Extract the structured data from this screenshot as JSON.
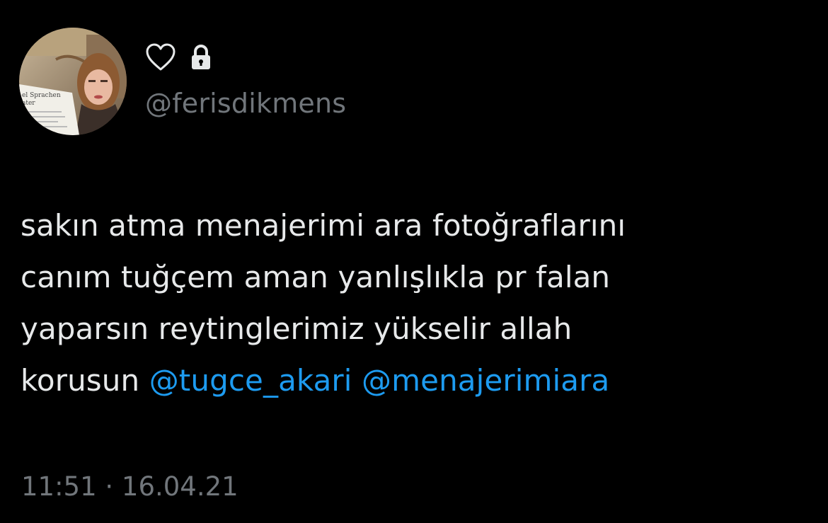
{
  "tweet": {
    "display_name_icons": [
      "heart-outline-icon",
      "lock-icon"
    ],
    "handle": "@ferisdikmens",
    "text_lines": [
      "sakın atma menajerimi ara fotoğraflarını",
      "canım tuğçem aman yanlışlıkla pr falan",
      "yaparsın reytinglerimiz yükselir allah",
      "korusun "
    ],
    "mentions": [
      "@tugce_akari",
      "@menajerimiara"
    ],
    "timestamp": "11:51 · 16.04.21",
    "avatar_newspaper_text": [
      "el Sprachen",
      "ater"
    ]
  },
  "colors": {
    "background": "#000000",
    "text": "#e7e9ea",
    "secondary": "#71767b",
    "link": "#1d9bf0"
  }
}
